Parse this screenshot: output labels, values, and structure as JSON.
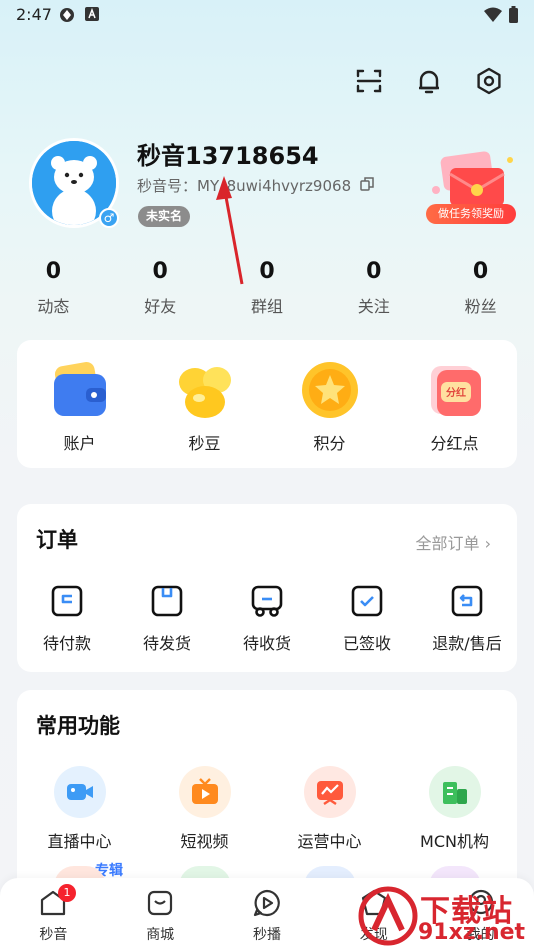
{
  "status_bar": {
    "time": "2:47"
  },
  "profile": {
    "username": "秒音13718654",
    "user_id": "秒音号：MY_8uwi4hvyrz9068",
    "realname_status": "未实名",
    "gender_symbol": "♂",
    "task_reward_label": "做任务领奖励"
  },
  "stats": [
    {
      "value": "0",
      "label": "动态"
    },
    {
      "value": "0",
      "label": "好友"
    },
    {
      "value": "0",
      "label": "群组"
    },
    {
      "value": "0",
      "label": "关注"
    },
    {
      "value": "0",
      "label": "粉丝"
    }
  ],
  "assets": [
    {
      "label": "账户",
      "icon": "wallet-icon",
      "color": "#4a86f5"
    },
    {
      "label": "秒豆",
      "icon": "bean-icon",
      "color": "#ffcc22"
    },
    {
      "label": "积分",
      "icon": "star-coin-icon",
      "color": "#ffb21c"
    },
    {
      "label": "分红点",
      "icon": "dividend-card-icon",
      "color": "#ff6a6a"
    }
  ],
  "orders": {
    "title": "订单",
    "all_label": "全部订单 ›",
    "items": [
      {
        "label": "待付款",
        "icon": "payment-pending-icon"
      },
      {
        "label": "待发货",
        "icon": "box-icon"
      },
      {
        "label": "待收货",
        "icon": "truck-icon"
      },
      {
        "label": "已签收",
        "icon": "check-box-icon"
      },
      {
        "label": "退款/售后",
        "icon": "refund-icon"
      }
    ]
  },
  "functions": {
    "title": "常用功能",
    "items": [
      {
        "label": "直播中心",
        "icon": "live-camera-icon",
        "color": "#3d9bf5"
      },
      {
        "label": "短视频",
        "icon": "tv-play-icon",
        "color": "#ff8a1f"
      },
      {
        "label": "运营中心",
        "icon": "chart-board-icon",
        "color": "#ff5a3c"
      },
      {
        "label": "MCN机构",
        "icon": "building-icon",
        "color": "#3dbf5c"
      }
    ],
    "special_tag": "专辑"
  },
  "bottom_nav": [
    {
      "label": "秒音",
      "icon": "home-icon",
      "badge": "1"
    },
    {
      "label": "商城",
      "icon": "shop-bag-icon"
    },
    {
      "label": "秒播",
      "icon": "play-bubble-icon"
    },
    {
      "label": "发现",
      "icon": "discover-icon"
    },
    {
      "label": "我的",
      "icon": "profile-icon"
    }
  ],
  "watermark": {
    "brand": "下载站",
    "url": "91xz.net"
  },
  "colors": {
    "accent": "#3aa3f2",
    "badge_red": "#f5222d",
    "arrow": "#d9252b"
  }
}
